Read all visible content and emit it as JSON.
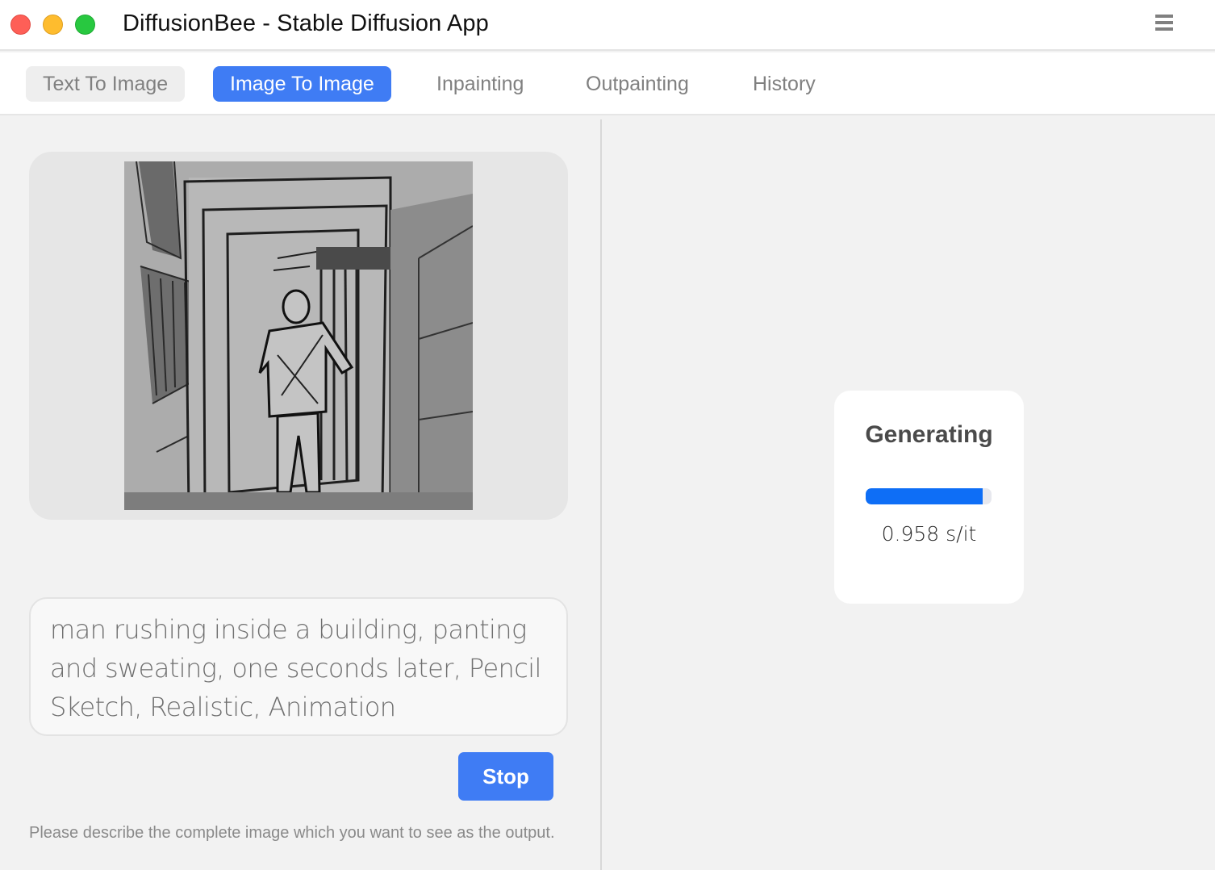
{
  "window": {
    "title": "DiffusionBee - Stable Diffusion App",
    "controls": [
      "close",
      "minimize",
      "zoom"
    ],
    "menu_icon": "hamburger-menu-icon"
  },
  "tabs": [
    {
      "label": "Text To Image",
      "state": "inactive-pill"
    },
    {
      "label": "Image To Image",
      "state": "active"
    },
    {
      "label": "Inpainting",
      "state": "inactive"
    },
    {
      "label": "Outpainting",
      "state": "inactive"
    },
    {
      "label": "History",
      "state": "inactive"
    }
  ],
  "input_image": {
    "description": "pencil sketch of a man standing in a doorway of a building"
  },
  "prompt": {
    "value": "man rushing inside a building, panting and sweating, one seconds later, Pencil Sketch, Realistic, Animation"
  },
  "stop_button": {
    "label": "Stop"
  },
  "hint": "Please describe the complete image which you want to see as the output.",
  "generation": {
    "title": "Generating",
    "progress_percent": 93,
    "speed": "0.958 s/it",
    "progress_color": "#0e6ef6"
  },
  "colors": {
    "accent": "#3f7cf4",
    "traffic_red": "#fe5f57",
    "traffic_yellow": "#febc2e",
    "traffic_green": "#28c840"
  }
}
